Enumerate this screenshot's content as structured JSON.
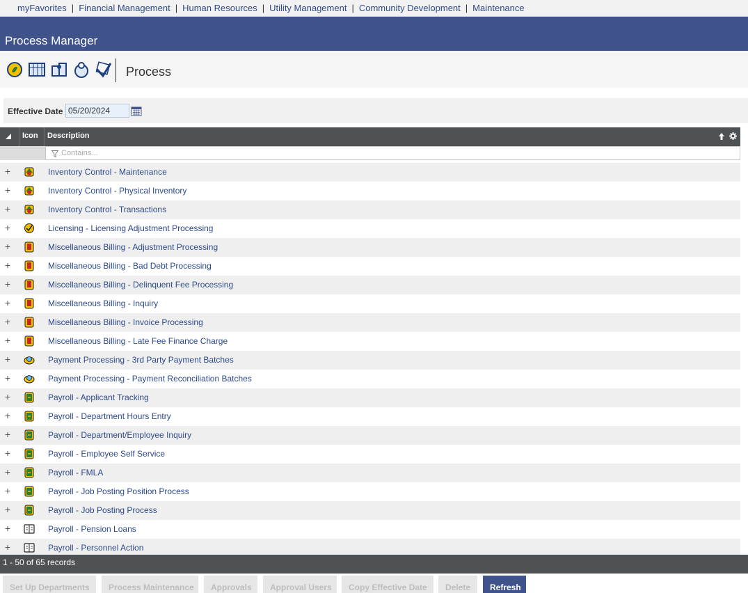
{
  "topnav": {
    "items": [
      "myFavorites",
      "Financial Management",
      "Human Resources",
      "Utility Management",
      "Community Development",
      "Maintenance"
    ]
  },
  "header": {
    "title": "Process Manager"
  },
  "toolbar": {
    "icons": [
      "money-icon",
      "calendar-grid-icon",
      "people-icon",
      "person-icon",
      "check-icon"
    ],
    "title": "Process"
  },
  "filter": {
    "effective_date_label": "Effective Date",
    "effective_date_value": "05/20/2024"
  },
  "grid": {
    "columns": [
      "Icon",
      "Description"
    ],
    "filter_placeholder": "Contains...",
    "rows": [
      {
        "icon": "inventory-icon",
        "description": "Inventory Control - Maintenance"
      },
      {
        "icon": "inventory-icon",
        "description": "Inventory Control - Physical Inventory"
      },
      {
        "icon": "inventory-icon",
        "description": "Inventory Control - Transactions"
      },
      {
        "icon": "licensing-icon",
        "description": "Licensing - Licensing Adjustment Processing"
      },
      {
        "icon": "billing-icon",
        "description": "Miscellaneous Billing - Adjustment Processing"
      },
      {
        "icon": "billing-icon",
        "description": "Miscellaneous Billing - Bad Debt Processing"
      },
      {
        "icon": "billing-icon",
        "description": "Miscellaneous Billing - Delinquent Fee Processing"
      },
      {
        "icon": "billing-icon",
        "description": "Miscellaneous Billing - Inquiry"
      },
      {
        "icon": "billing-icon",
        "description": "Miscellaneous Billing - Invoice Processing"
      },
      {
        "icon": "billing-icon",
        "description": "Miscellaneous Billing - Late Fee Finance Charge"
      },
      {
        "icon": "payment-icon",
        "description": "Payment Processing - 3rd Party Payment Batches"
      },
      {
        "icon": "payment-icon",
        "description": "Payment Processing - Payment Reconciliation Batches"
      },
      {
        "icon": "payroll-icon",
        "description": "Payroll - Applicant Tracking"
      },
      {
        "icon": "payroll-icon",
        "description": "Payroll - Department Hours Entry"
      },
      {
        "icon": "payroll-icon",
        "description": "Payroll - Department/Employee Inquiry"
      },
      {
        "icon": "payroll-icon",
        "description": "Payroll - Employee Self Service"
      },
      {
        "icon": "payroll-icon",
        "description": "Payroll - FMLA"
      },
      {
        "icon": "payroll-icon",
        "description": "Payroll - Job Posting Position Process"
      },
      {
        "icon": "payroll-icon",
        "description": "Payroll - Job Posting Process"
      },
      {
        "icon": "book-icon",
        "description": "Payroll - Pension Loans"
      },
      {
        "icon": "book-icon",
        "description": "Payroll - Personnel Action"
      }
    ]
  },
  "footer": {
    "records": "1 - 50 of 65 records"
  },
  "buttons": [
    {
      "label": "Set Up Departments",
      "active": false
    },
    {
      "label": "Process Maintenance",
      "active": false
    },
    {
      "label": "Approvals",
      "active": false
    },
    {
      "label": "Approval Users",
      "active": false
    },
    {
      "label": "Copy Effective Date",
      "active": false
    },
    {
      "label": "Delete",
      "active": false
    },
    {
      "label": "Refresh",
      "active": true
    }
  ],
  "colors": {
    "brand": "#3f5289",
    "link": "#2d4a8a",
    "grid_header": "#4f5254"
  }
}
